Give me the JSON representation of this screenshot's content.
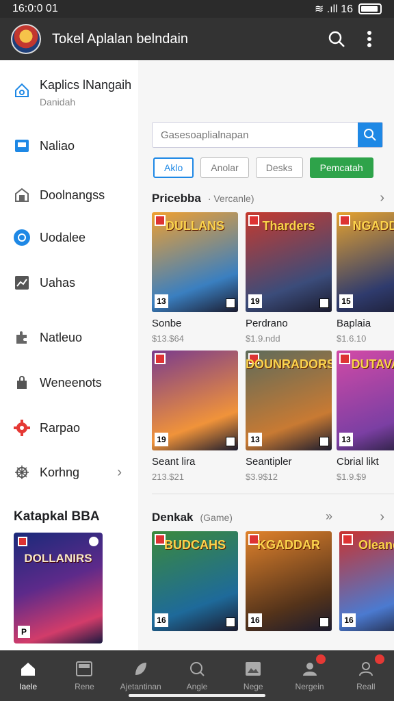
{
  "status": {
    "time": "16:0:0 01",
    "icons": "≋ .ıll 16"
  },
  "appbar": {
    "title": "Tokel Aplalan belndain"
  },
  "drawer": {
    "header": {
      "label": "Kaplics lNangaih",
      "sub": "Danidah"
    },
    "items": [
      {
        "label": "Naliao",
        "icon": "bookmark-icon"
      },
      {
        "label": "Doolnangss",
        "icon": "store-icon"
      },
      {
        "label": "Uodalee",
        "icon": "sync-icon"
      },
      {
        "label": "Uahas",
        "icon": "trend-icon"
      },
      {
        "label": "Natleuo",
        "icon": "puzzle-icon"
      },
      {
        "label": "Weneenots",
        "icon": "bag-icon"
      },
      {
        "label": "Rarpao",
        "icon": "gear-red-icon"
      },
      {
        "label": "Korhng",
        "icon": "settings-icon"
      }
    ],
    "category_title": "Katapkal BBA",
    "cover_caption": "DOLLANIRS",
    "cover_rating": "P"
  },
  "search": {
    "placeholder": "Gasesoaplialnapan"
  },
  "chips": [
    "Aklo",
    "Anolar",
    "Desks",
    "Pemcatah"
  ],
  "section1": {
    "title": "Pricebba",
    "subtitle": "· Vercanle)"
  },
  "section2": {
    "title": "Denkak",
    "subtitle": "(Game)"
  },
  "grid1": [
    {
      "name": "Sonbe",
      "price": "$13.$64",
      "rating": "13",
      "cap": "DULLANS",
      "colors": [
        "#f0a030",
        "#3a7fc0"
      ]
    },
    {
      "name": "Perdrano",
      "price": "$1.9.ndd",
      "rating": "19",
      "cap": "Tharders",
      "colors": [
        "#c63a2e",
        "#3b4c7a"
      ]
    },
    {
      "name": "Baplaia",
      "price": "$1.6.10",
      "rating": "15",
      "cap": "NGADDR",
      "colors": [
        "#e5a22f",
        "#2f3b6d"
      ]
    },
    {
      "name": "Seant lira",
      "price": "213.$21",
      "rating": "19",
      "cap": "",
      "colors": [
        "#7a3b8c",
        "#f0933a"
      ]
    },
    {
      "name": "Seantipler",
      "price": "$3.9$12",
      "rating": "13",
      "cap": "DOUNRADORS",
      "colors": [
        "#5e6b5a",
        "#c87a33"
      ]
    },
    {
      "name": "Cbrial likt",
      "price": "$1.9.$9",
      "rating": "13",
      "cap": "DUTAVAS",
      "colors": [
        "#d24aa6",
        "#7b3fa3"
      ]
    }
  ],
  "grid2": [
    {
      "rating": "16",
      "cap": "BUDCAHS",
      "colors": [
        "#3b8a3c",
        "#1e6a9a"
      ]
    },
    {
      "rating": "16",
      "cap": "KGADDAR",
      "colors": [
        "#e0822c",
        "#54331a"
      ]
    },
    {
      "rating": "16",
      "cap": "Oleanes",
      "colors": [
        "#c9332f",
        "#4b7ad0"
      ]
    }
  ],
  "nav": [
    {
      "label": "Iaele",
      "icon": "home-icon",
      "active": true
    },
    {
      "label": "Rene",
      "icon": "inbox-icon"
    },
    {
      "label": "Ajetantinan",
      "icon": "leaf-icon"
    },
    {
      "label": "Angle",
      "icon": "search-circle-icon"
    },
    {
      "label": "Nege",
      "icon": "image-icon"
    },
    {
      "label": "Nergein",
      "icon": "person-icon",
      "badge": true
    },
    {
      "label": "Reall",
      "icon": "account-icon",
      "badge": true
    }
  ]
}
